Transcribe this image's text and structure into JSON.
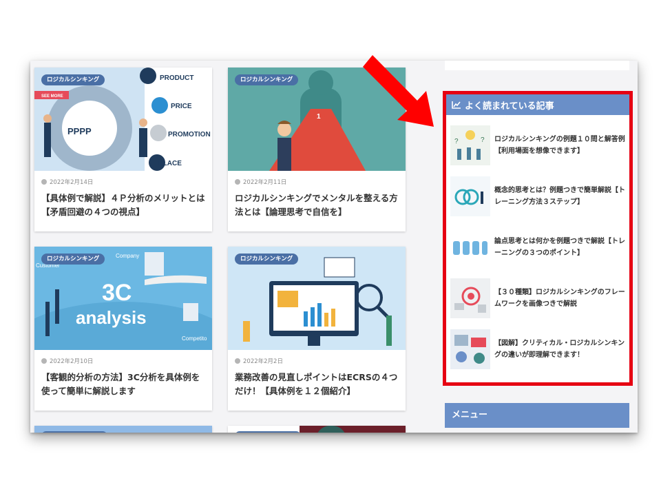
{
  "cards": [
    {
      "category": "ロジカルシンキング",
      "date": "2022年2月14日",
      "title": "【具体例で解説】４Ｐ分析のメリットとは【矛盾回避の４つの視点】",
      "thumb_text": [
        "PRODUCT",
        "PRICE",
        "PROMOTION",
        "PLACE",
        "PPPP",
        "SEE MORE"
      ]
    },
    {
      "category": "ロジカルシンキング",
      "date": "2022年2月11日",
      "title": "ロジカルシンキングでメンタルを整える方法とは【論理思考で自信を】",
      "thumb_text": [
        "1"
      ]
    },
    {
      "category": "ロジカルシンキング",
      "date": "2022年2月10日",
      "title": "【客観的分析の方法】3C分析を具体例を使って簡単に解説します",
      "thumb_text": [
        "3C",
        "analysis",
        "Customer",
        "Company",
        "Competito"
      ]
    },
    {
      "category": "ロジカルシンキング",
      "date": "2022年2月2日",
      "title": "業務改善の見直しポイントはECRSの４つだけ！【具体例を１２個紹介】",
      "thumb_text": []
    }
  ],
  "sidebar": {
    "popular_title": "よく読まれている記事",
    "items": [
      {
        "title": "ロジカルシンキングの例題１０問と解答例【利用場面を想像できます】"
      },
      {
        "title": "概念的思考とは？例題つきで簡単解説【トレーニング方法３ステップ】"
      },
      {
        "title": "論点思考とは何かを例題つきで解説【トレーニングの３つのポイント】"
      },
      {
        "title": "【３０種類】ロジカルシンキングのフレームワークを画像つきで解説"
      },
      {
        "title": "【図解】クリティカル・ロジカルシンキングの違いが即理解できます！"
      }
    ],
    "menu_title": "メニュー"
  },
  "colors": {
    "highlight": "#e60012",
    "header": "#6a8fc8",
    "badge": "#4a6fa5"
  },
  "icons": {
    "popular": "chart-line-icon",
    "date": "clock-icon",
    "arrow": "red-arrow"
  }
}
